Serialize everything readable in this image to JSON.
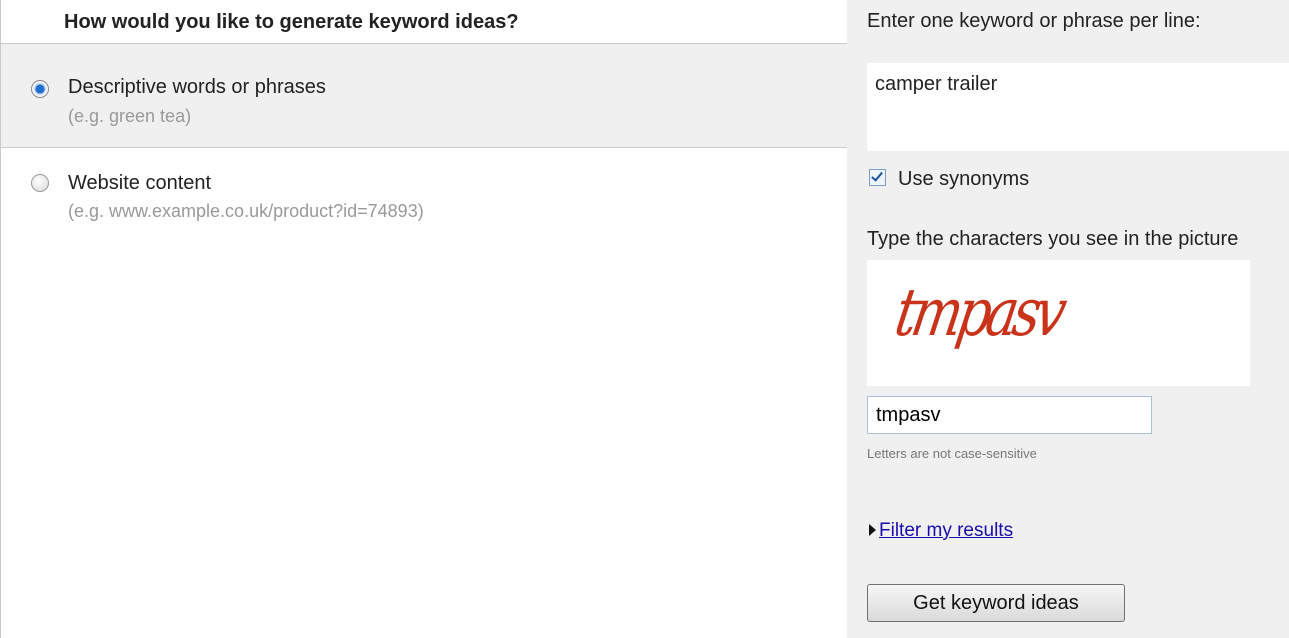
{
  "left_panel": {
    "heading": "How would you like to generate keyword ideas?",
    "options": [
      {
        "label": "Descriptive words or phrases",
        "hint": "(e.g. green tea)",
        "selected": true
      },
      {
        "label": "Website content",
        "hint": "(e.g. www.example.co.uk/product?id=74893)",
        "selected": false
      }
    ]
  },
  "right_panel": {
    "keyword_prompt": "Enter one keyword or phrase per line:",
    "keywords_value": "camper trailer",
    "use_synonyms_label": "Use synonyms",
    "use_synonyms_checked": true,
    "captcha_prompt": "Type the characters you see in the picture",
    "captcha_image_text": "tmpasv",
    "captcha_input_value": "tmpasv",
    "case_hint": "Letters are not case-sensitive",
    "filter_link": "Filter my results",
    "submit_button": "Get keyword ideas"
  },
  "colors": {
    "panel_background": "#f0f0f0",
    "link": "#1a0dab",
    "captcha_text": "#c8331a",
    "hint_text": "#999999"
  }
}
